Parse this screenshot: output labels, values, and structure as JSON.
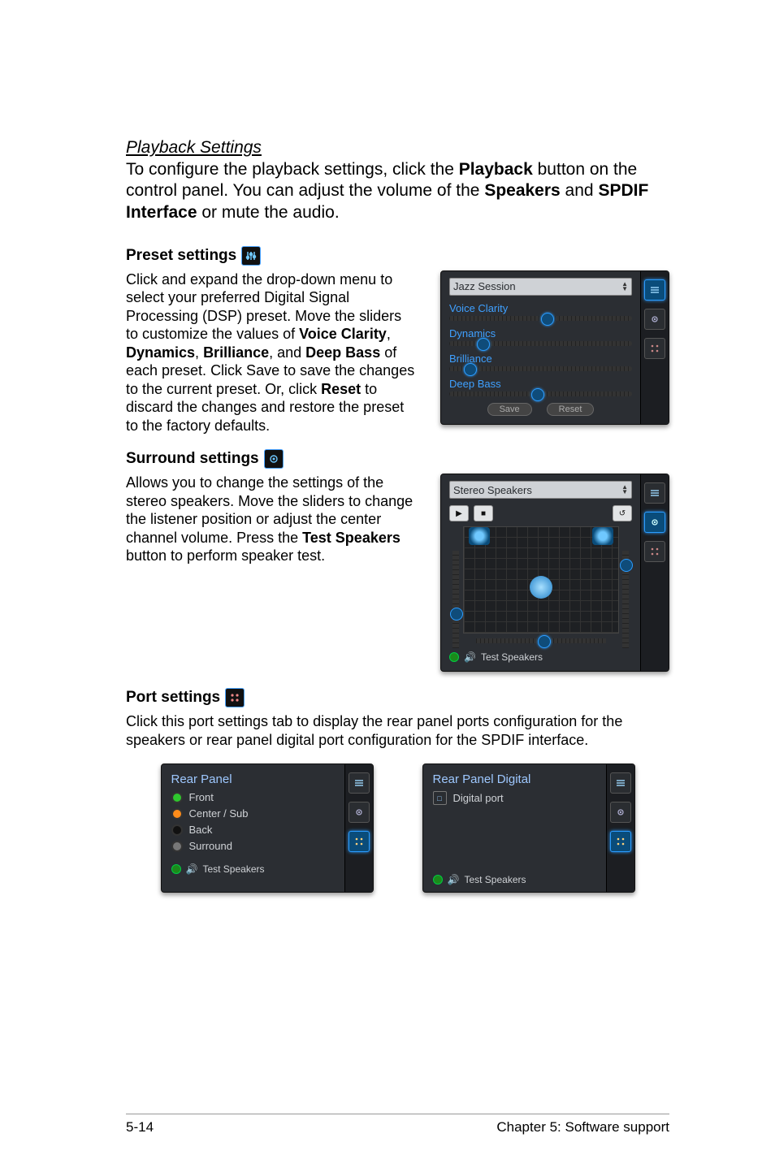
{
  "section": {
    "title": "Playback Settings",
    "intro_parts": [
      "To configure the playback settings, click the ",
      "Playback",
      " button on the control panel. You can adjust the volume of the ",
      "Speakers",
      " and ",
      "SPDIF Interface",
      " or mute the audio."
    ]
  },
  "preset": {
    "heading": "Preset settings",
    "body_parts": [
      "Click and expand the drop-down menu to select your preferred Digital Signal Processing (DSP) preset. Move the sliders to customize the values of ",
      "Voice Clarity",
      ", ",
      "Dynamics",
      ", ",
      "Brilliance",
      ", and ",
      "Deep Bass",
      " of each preset. Click Save to save the changes to the current preset. Or, click ",
      "Reset",
      " to discard the changes and restore the preset to the factory defaults."
    ],
    "panel": {
      "dropdown": "Jazz Session",
      "sliders": [
        {
          "label": "Voice Clarity",
          "pos": 50
        },
        {
          "label": "Dynamics",
          "pos": 15
        },
        {
          "label": "Brilliance",
          "pos": 8
        },
        {
          "label": "Deep Bass",
          "pos": 45
        }
      ],
      "save": "Save",
      "reset": "Reset"
    }
  },
  "surround": {
    "heading": "Surround settings",
    "body_parts": [
      "Allows you to change the settings of the stereo speakers. Move the sliders to change the listener position or adjust the center channel volume. Press the ",
      "Test Speakers",
      " button to perform speaker test."
    ],
    "panel": {
      "dropdown": "Stereo Speakers",
      "test": "Test Speakers"
    }
  },
  "port": {
    "heading": "Port settings",
    "body": "Click this port settings tab to display the rear panel ports configuration for the speakers or rear panel digital port configuration for the SPDIF interface.",
    "analog": {
      "title": "Rear Panel",
      "items": [
        "Front",
        "Center / Sub",
        "Back",
        "Surround"
      ],
      "test": "Test Speakers"
    },
    "digital": {
      "title": "Rear Panel Digital",
      "item": "Digital port",
      "test": "Test Speakers"
    }
  },
  "footer": {
    "left": "5-14",
    "right": "Chapter 5: Software support"
  }
}
